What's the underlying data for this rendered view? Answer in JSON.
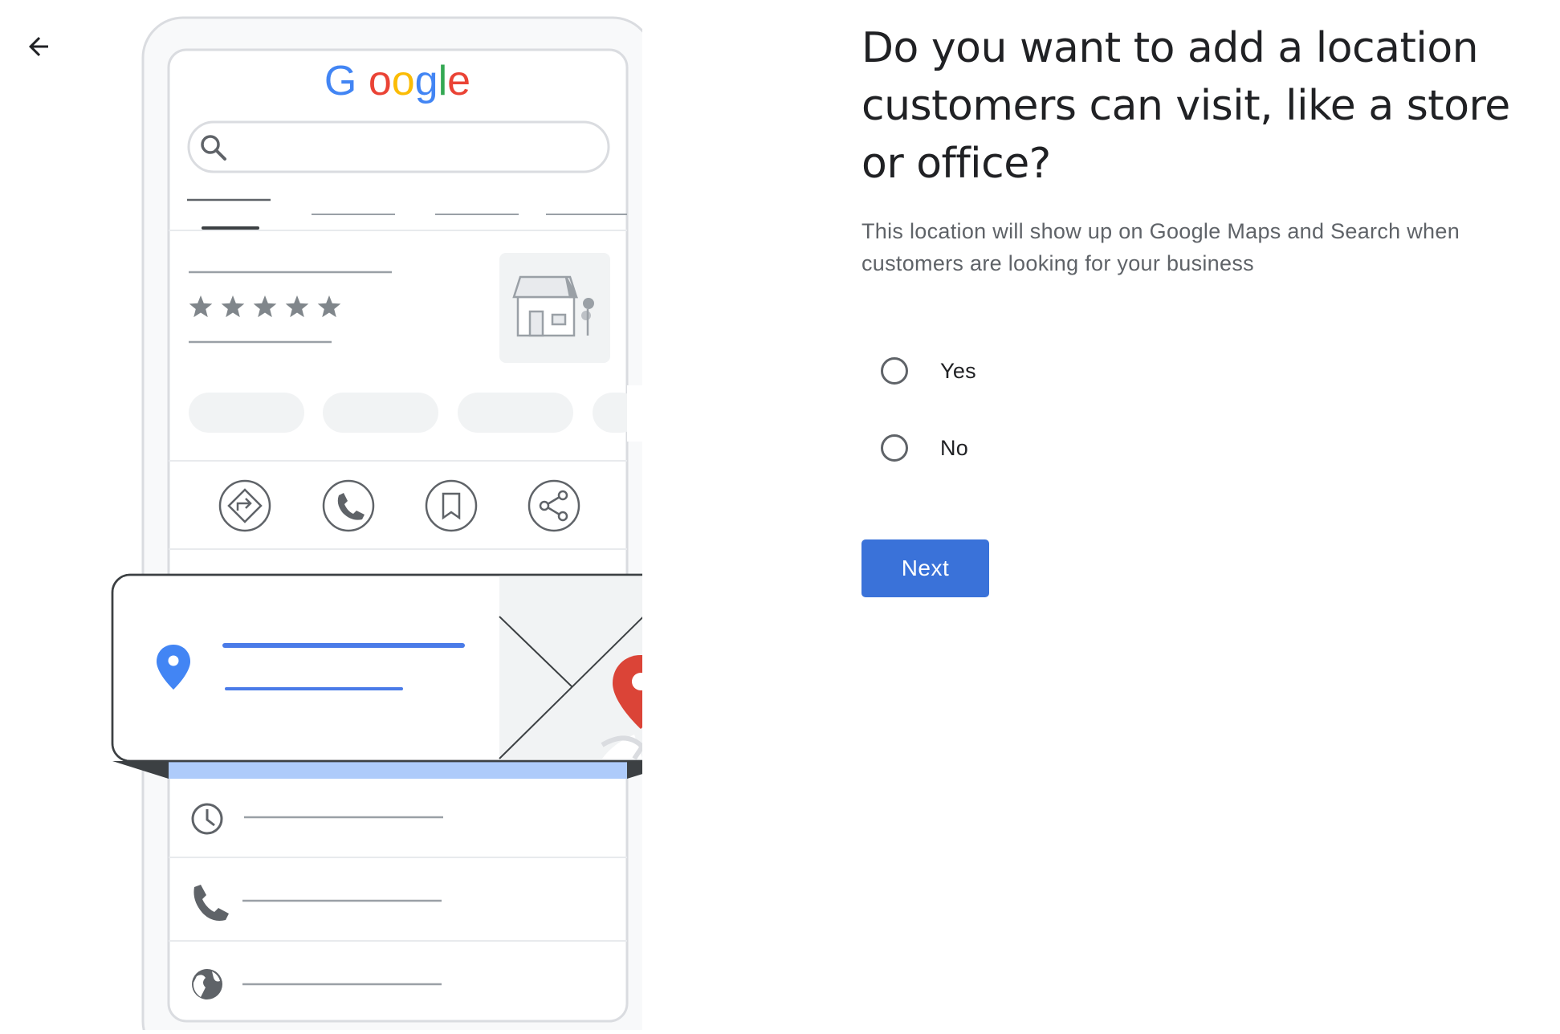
{
  "nav": {
    "back_icon": "arrow-left-icon"
  },
  "illustration": {
    "brand_text": "Google",
    "brand_colors": [
      "#4285F4",
      "#EA4335",
      "#FBBC05",
      "#4285F4",
      "#34A853",
      "#EA4335"
    ],
    "rating_stars": 5,
    "action_icons": [
      "directions-icon",
      "phone-icon",
      "bookmark-icon",
      "share-icon"
    ],
    "info_icons": [
      "clock-icon",
      "phone-icon",
      "globe-icon"
    ],
    "pin_colors": {
      "blue": "#4285F4",
      "red": "#DB4437"
    }
  },
  "form": {
    "question": "Do you want to add a location customers can visit, like a store or office?",
    "description": "This location will show up on Google Maps and Search when customers are looking for your business",
    "options": [
      {
        "label": "Yes",
        "selected": false
      },
      {
        "label": "No",
        "selected": false
      }
    ],
    "next_label": "Next",
    "accent_color": "#3A72D9"
  }
}
